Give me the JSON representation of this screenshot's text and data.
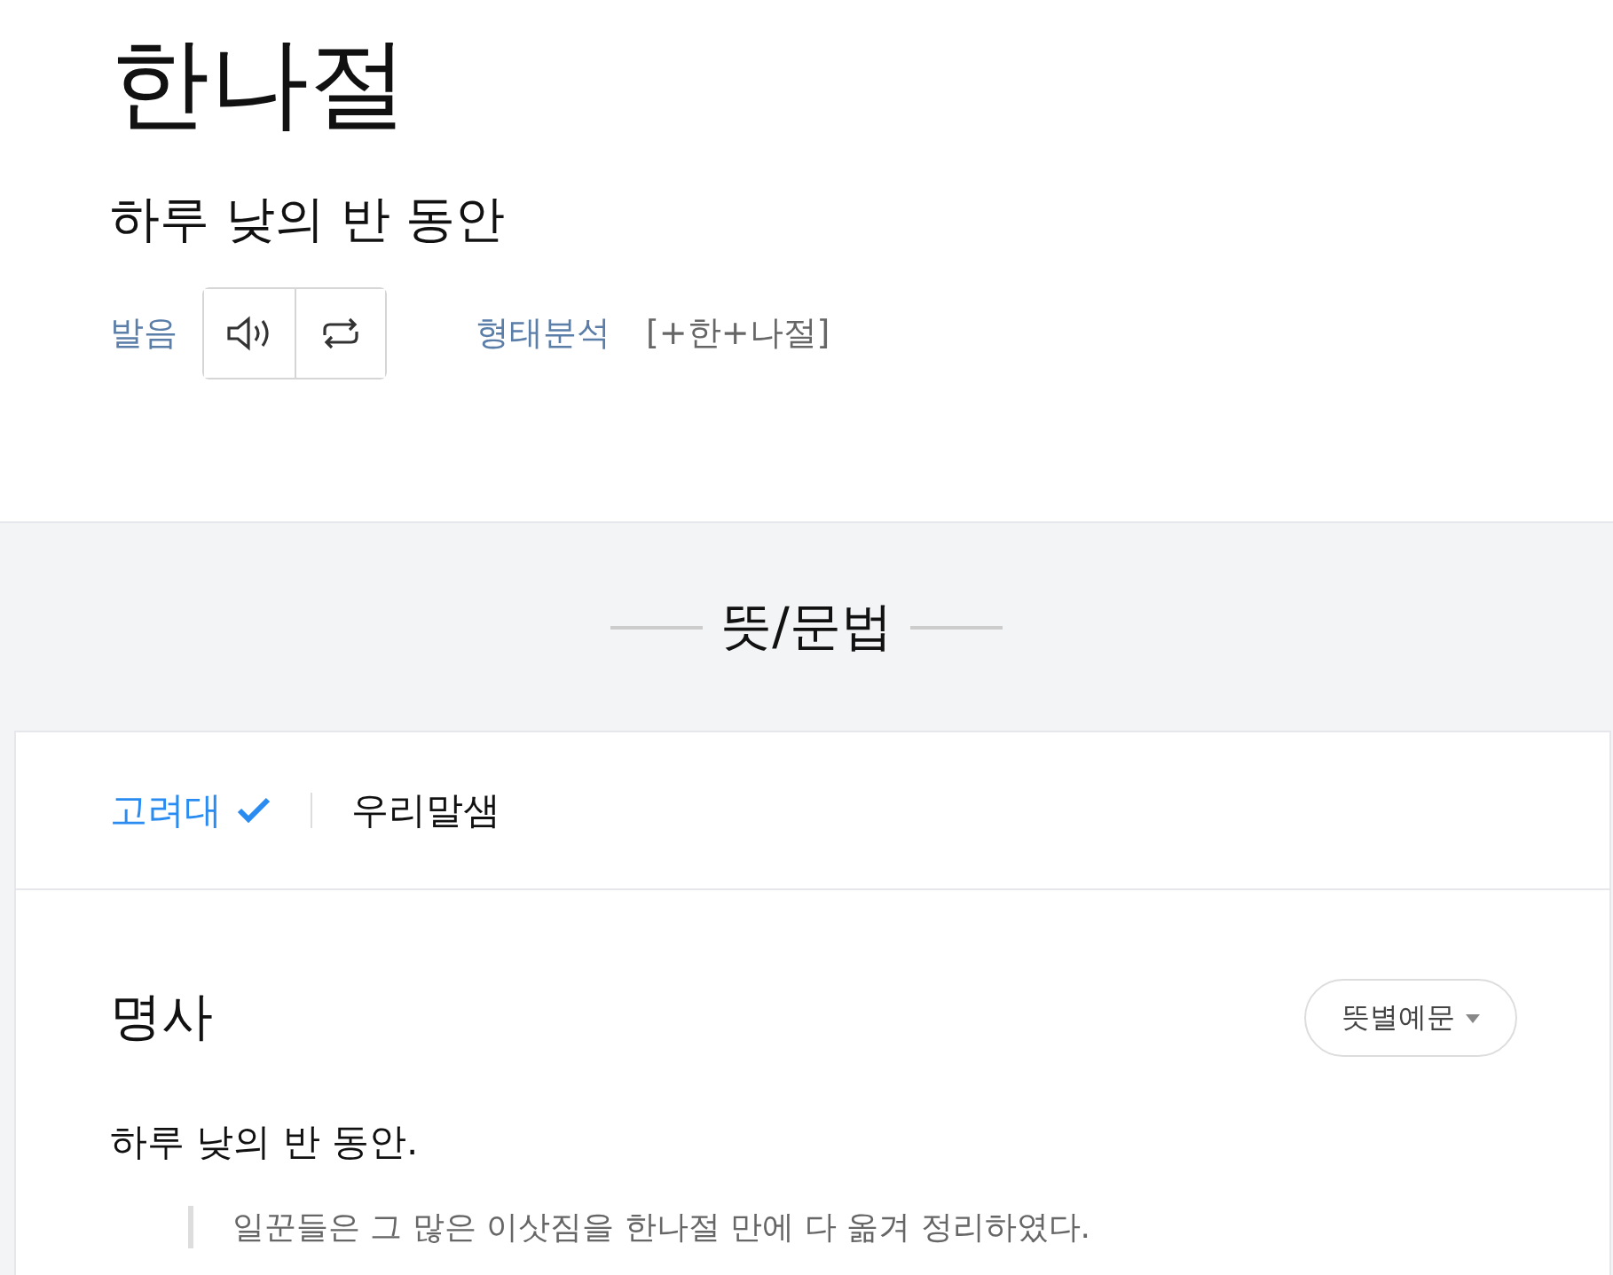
{
  "headword": "한나절",
  "summary": "하루 낮의 반 동안",
  "pronunciation": {
    "label": "발음"
  },
  "morphology": {
    "label": "형태분석",
    "value": "[+한+나절]"
  },
  "section_title": "뜻/문법",
  "tabs": [
    {
      "label": "고려대",
      "selected": true
    },
    {
      "label": "우리말샘",
      "selected": false
    }
  ],
  "entry": {
    "part_of_speech": "명사",
    "dropdown": "뜻별예문",
    "definition": "하루 낮의 반 동안.",
    "example": "일꾼들은 그 많은 이삿짐을 한나절 만에 다 옮겨 정리하였다."
  }
}
